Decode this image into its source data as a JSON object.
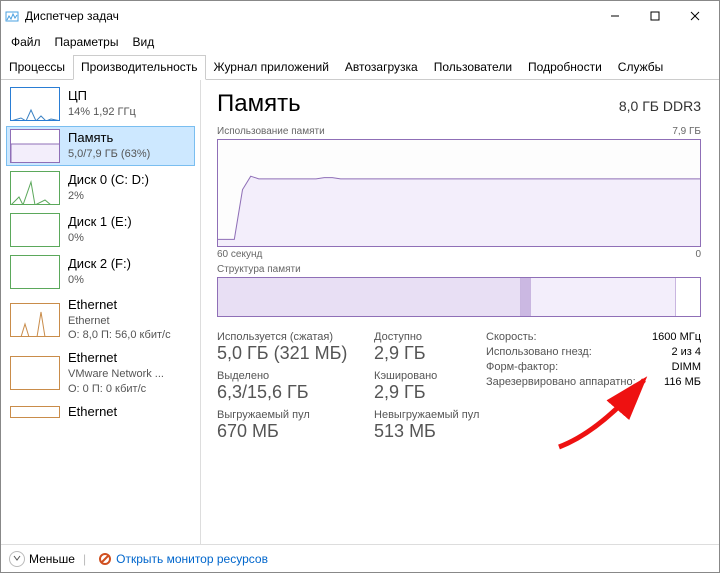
{
  "window": {
    "title": "Диспетчер задач"
  },
  "menu": {
    "file": "Файл",
    "options": "Параметры",
    "view": "Вид"
  },
  "tabs": {
    "processes": "Процессы",
    "performance": "Производительность",
    "app_history": "Журнал приложений",
    "startup": "Автозагрузка",
    "users": "Пользователи",
    "details": "Подробности",
    "services": "Службы"
  },
  "sidebar": {
    "items": [
      {
        "title": "ЦП",
        "subtitle": "14% 1,92 ГГц"
      },
      {
        "title": "Память",
        "subtitle": "5,0/7,9 ГБ (63%)"
      },
      {
        "title": "Диск 0 (C: D:)",
        "subtitle": "2%"
      },
      {
        "title": "Диск 1 (E:)",
        "subtitle": "0%"
      },
      {
        "title": "Диск 2 (F:)",
        "subtitle": "0%"
      },
      {
        "title": "Ethernet",
        "subtitle": "Ethernet",
        "subtitle2": "О: 8,0 П: 56,0 кбит/с"
      },
      {
        "title": "Ethernet",
        "subtitle": "VMware Network ...",
        "subtitle2": "О: 0 П: 0 кбит/с"
      },
      {
        "title": "Ethernet",
        "subtitle": ""
      }
    ],
    "selected": 1
  },
  "main": {
    "title": "Память",
    "spec": "8,0 ГБ DDR3",
    "usage_label": "Использование памяти",
    "usage_max": "7,9 ГБ",
    "x_left": "60 секунд",
    "x_right": "0",
    "composition_label": "Структура памяти",
    "stats": {
      "in_use_label": "Используется (сжатая)",
      "in_use_value": "5,0 ГБ (321 МБ)",
      "available_label": "Доступно",
      "available_value": "2,9 ГБ",
      "committed_label": "Выделено",
      "committed_value": "6,3/15,6 ГБ",
      "cached_label": "Кэшировано",
      "cached_value": "2,9 ГБ",
      "paged_label": "Выгружаемый пул",
      "paged_value": "670 МБ",
      "nonpaged_label": "Невыгружаемый пул",
      "nonpaged_value": "513 МБ"
    },
    "right": {
      "speed_label": "Скорость:",
      "speed_value": "1600 МГц",
      "slots_label": "Использовано гнезд:",
      "slots_value": "2 из 4",
      "form_label": "Форм-фактор:",
      "form_value": "DIMM",
      "reserved_label": "Зарезервировано аппаратно:",
      "reserved_value": "116 МБ"
    }
  },
  "footer": {
    "fewer": "Меньше",
    "resmon": "Открыть монитор ресурсов"
  },
  "chart_data": {
    "type": "line",
    "title": "Использование памяти",
    "xlabel": "секунд",
    "ylabel": "ГБ",
    "ylim": [
      0,
      7.9
    ],
    "x_range_seconds": [
      60,
      0
    ],
    "values": [
      0.5,
      0.5,
      0.5,
      4.2,
      5.2,
      5.0,
      5.0,
      5.0,
      5.0,
      5.0,
      5.0,
      5.0,
      5.0,
      5.1,
      5.1,
      5.0,
      5.0,
      5.0,
      5.0,
      5.0,
      5.0,
      5.0,
      5.0,
      5.0,
      5.0,
      5.0,
      5.0,
      5.0,
      5.0,
      5.0,
      5.0,
      5.0,
      5.0,
      5.0,
      5.0,
      5.0,
      5.0,
      5.0,
      5.0,
      5.0,
      5.0,
      5.0,
      5.0,
      5.0,
      5.0,
      5.0,
      5.0,
      5.0,
      5.0,
      5.0,
      5.0,
      5.0,
      5.0,
      5.0,
      5.0,
      5.0,
      5.0,
      5.0,
      5.0,
      5.0
    ]
  },
  "composition_data": {
    "segments": [
      {
        "label": "in_use",
        "fraction": 0.63,
        "fill": "#e8dff4"
      },
      {
        "label": "modified",
        "fraction": 0.02,
        "fill": "#cbb8e2"
      },
      {
        "label": "standby",
        "fraction": 0.3,
        "fill": "#f3eefb"
      },
      {
        "label": "free",
        "fraction": 0.05,
        "fill": "#ffffff"
      }
    ]
  }
}
